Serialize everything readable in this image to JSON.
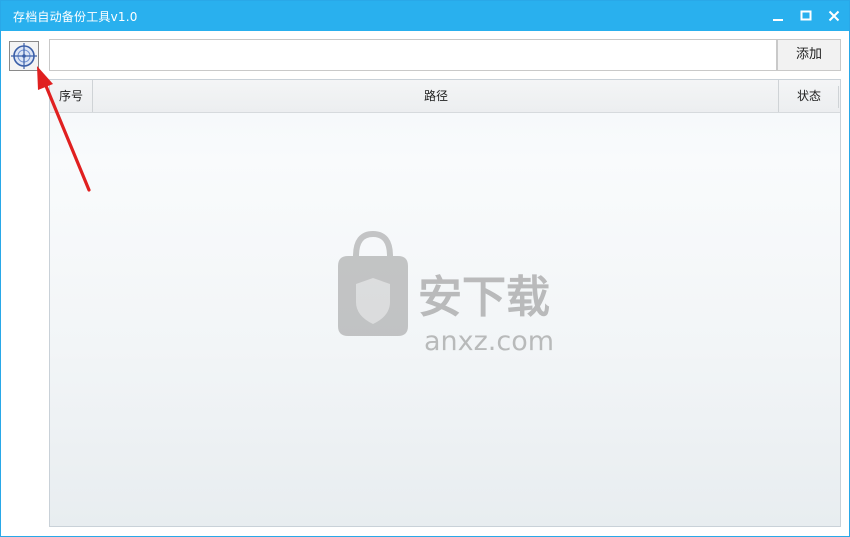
{
  "window": {
    "title": "存档自动备份工具v1.0",
    "titlebar_color": "#29b0ee"
  },
  "toolbar": {
    "target_button_icon": "crosshair-icon",
    "path_input_value": "",
    "add_label": "添加"
  },
  "table": {
    "columns": [
      "序号",
      "路径",
      "状态"
    ],
    "rows": []
  },
  "watermark": {
    "name": "安下载",
    "domain": "anxz.com"
  },
  "annotation": {
    "arrow_color": "#e02020"
  }
}
